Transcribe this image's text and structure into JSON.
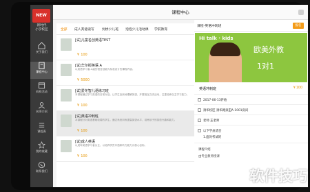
{
  "app": {
    "logo_text": "NEW",
    "org_name": "新时代\n小学校区"
  },
  "sidebar": {
    "items": [
      {
        "label": "关于我们",
        "icon": "home-icon"
      },
      {
        "label": "课程中心",
        "icon": "book-icon"
      },
      {
        "label": "机构活动",
        "icon": "calendar-icon"
      },
      {
        "label": "名师介绍",
        "icon": "person-icon"
      },
      {
        "label": "课程表",
        "icon": "list-icon"
      },
      {
        "label": "我的收藏",
        "icon": "star-icon"
      },
      {
        "label": "联系我们",
        "icon": "phone-icon"
      }
    ],
    "active_index": 1
  },
  "header": {
    "title": "课程中心"
  },
  "tabs": [
    {
      "label": "全部",
      "active": true
    },
    {
      "label": "成人英语读写",
      "active": false
    },
    {
      "label": "剑桥少儿班",
      "active": false
    },
    {
      "label": "泡泡少儿活动课",
      "active": false
    },
    {
      "label": "学前教育",
      "active": false
    }
  ],
  "courses": [
    {
      "name": "[试]儿童名创英语TEST",
      "desc": "",
      "price": "100"
    },
    {
      "name": "[试]华尔街英语 A",
      "desc": "以英语学习者-A级的语言技能为标准设计的课程内容。",
      "price": "5000"
    },
    {
      "name": "[试]爱冬智儿语练习班",
      "desc": "本课程通过学习英语的日常对话，让学生自然地理解英语，开展相互交流活动，注重培养自主学习能力。",
      "price": "100"
    },
    {
      "name": "[试]英语冲刺班",
      "desc": "本课程针对英语基础较弱的学生，通过系统训练提高英语水平，培养孩子的英语兴趣和能力。",
      "price": "100",
      "highlight": true
    },
    {
      "name": "[试]成人英语",
      "desc": "以成年英语学习者为主，以培养学员口语和听力能力为核心目标。",
      "price": "100"
    }
  ],
  "detail": {
    "header_text": "课程-英语冲刺班",
    "header_button": "报名",
    "banner": {
      "brand": "Hi talk · kids",
      "headline": "欧美外教",
      "sub": "1对1"
    },
    "course_name": "英语冲刺班",
    "price": "100",
    "date": "2017-06-13开始",
    "location": "清华校区  清华路泉田A-1001房间",
    "teacher": "老师 王老师",
    "target_title": "以下学员适合",
    "target_item": "1.面对考试的",
    "intro_title": "课程介绍",
    "intro_text": "由专业教师授课"
  },
  "watermark": "软件技巧"
}
